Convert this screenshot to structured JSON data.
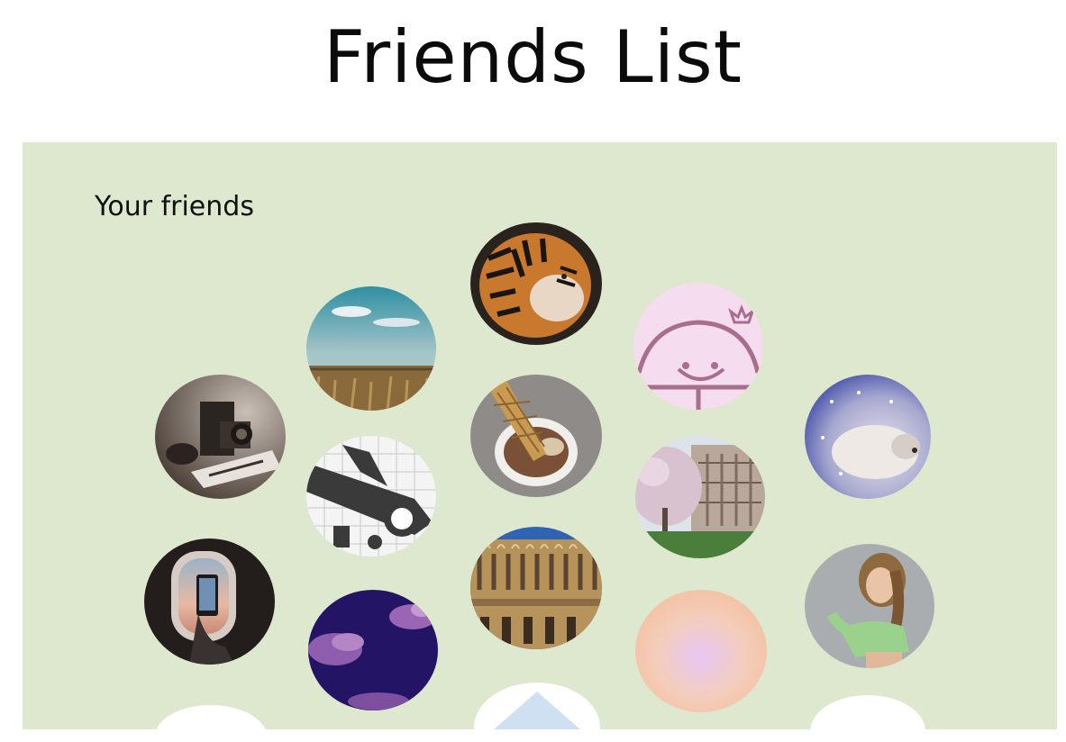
{
  "page": {
    "title": "Friends List"
  },
  "friends_section": {
    "heading": "Your friends"
  },
  "colors": {
    "panel_background": "#dde8cf",
    "page_background": "#ffffff"
  },
  "friends": [
    {
      "name": "tiger-avatar"
    },
    {
      "name": "field-sky-avatar"
    },
    {
      "name": "princess-character-avatar"
    },
    {
      "name": "vintage-camera-avatar"
    },
    {
      "name": "ice-cream-cone-avatar"
    },
    {
      "name": "snow-animal-avatar"
    },
    {
      "name": "maze-airplane-avatar"
    },
    {
      "name": "cherry-blossom-campus-avatar"
    },
    {
      "name": "airplane-window-phone-avatar"
    },
    {
      "name": "gothic-library-avatar"
    },
    {
      "name": "singer-portrait-avatar"
    },
    {
      "name": "purple-clouds-avatar"
    },
    {
      "name": "peach-gradient-avatar"
    }
  ]
}
